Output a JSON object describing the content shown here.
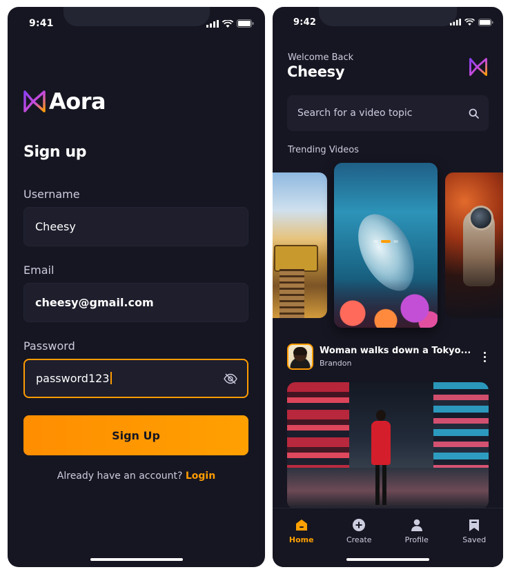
{
  "colors": {
    "background": "#161622",
    "input_background": "#1e1e2d",
    "accent": "#ff9c01",
    "muted_text": "#cdcde0",
    "logo_purple": "#8a3ff2"
  },
  "signup_screen": {
    "status_time": "9:41",
    "logo_text": "Aora",
    "title": "Sign up",
    "username": {
      "label": "Username",
      "value": "Cheesy"
    },
    "email": {
      "label": "Email",
      "value": "cheesy@gmail.com"
    },
    "password": {
      "label": "Password",
      "value": "password123",
      "visibility_icon": "eye-off-icon"
    },
    "signup_button": "Sign Up",
    "footer_text": "Already have an account?",
    "login_link": "Login"
  },
  "home_screen": {
    "status_time": "9:42",
    "welcome_text": "Welcome Back",
    "username": "Cheesy",
    "search": {
      "placeholder": "Search for a video topic",
      "icon": "search-icon"
    },
    "trending_title": "Trending Videos",
    "trending_carousel": {
      "item_count": 3,
      "active_index": 1,
      "dot_count": 3
    },
    "video": {
      "title": "Woman walks down a Tokyo...",
      "author": "Brandon"
    },
    "tabs": [
      {
        "label": "Home",
        "icon": "home-icon",
        "active": true
      },
      {
        "label": "Create",
        "icon": "plus-circle-icon",
        "active": false
      },
      {
        "label": "Profile",
        "icon": "profile-icon",
        "active": false
      },
      {
        "label": "Saved",
        "icon": "bookmark-icon",
        "active": false
      }
    ]
  }
}
